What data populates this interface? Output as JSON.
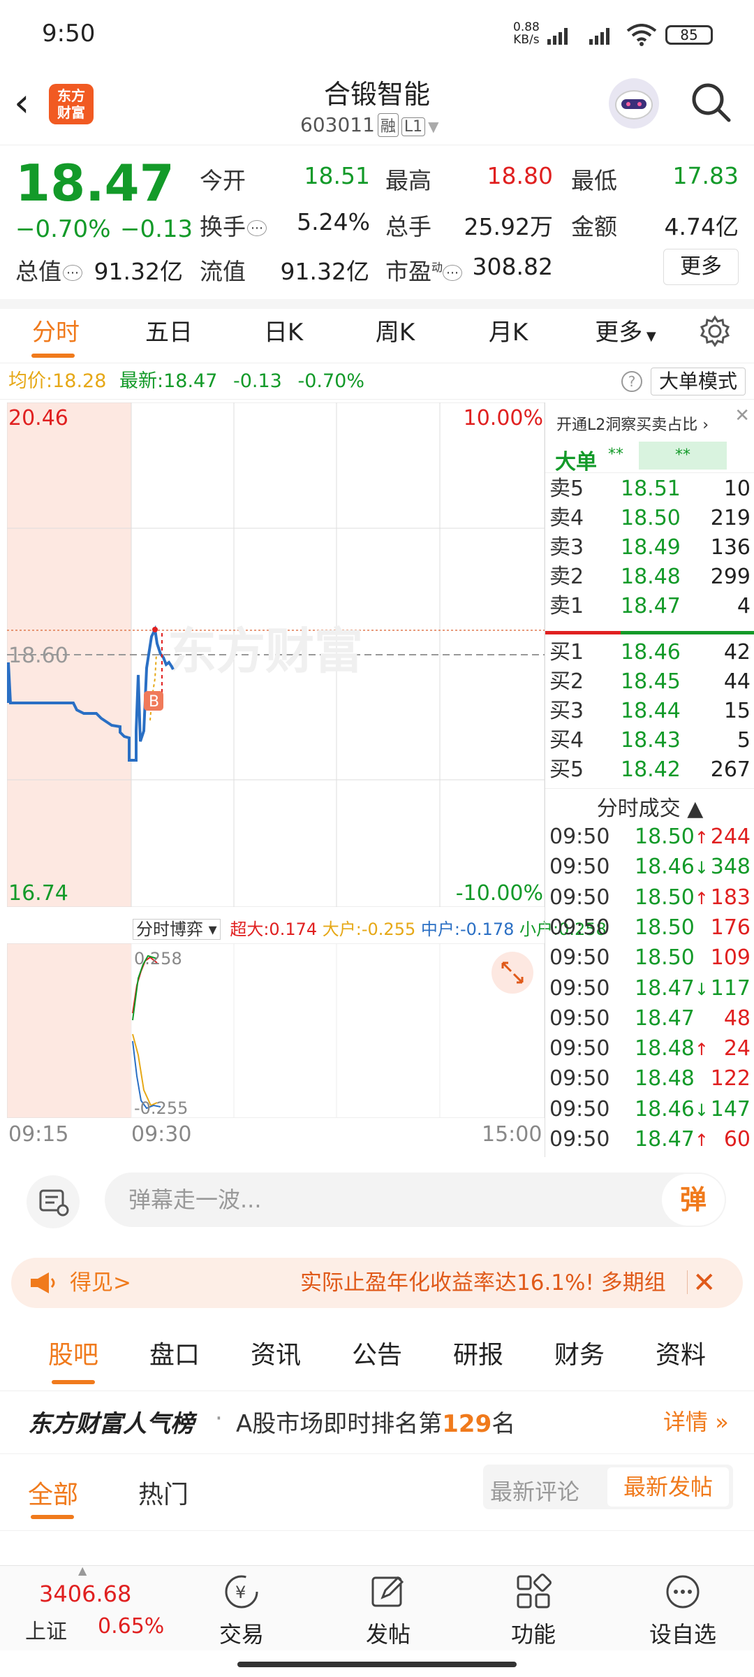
{
  "status": {
    "time": "9:50",
    "net_speed_value": "0.88",
    "net_speed_unit": "KB/s",
    "battery": "85"
  },
  "header": {
    "title": "合锻智能",
    "code": "603011",
    "tag_rong": "融",
    "tag_level": "L1",
    "logo_line1": "东方",
    "logo_line2": "财富"
  },
  "quote": {
    "price": "18.47",
    "change_pct": "−0.70%",
    "change_abs": "−0.13",
    "open_label": "今开",
    "open": "18.51",
    "high_label": "最高",
    "high": "18.80",
    "low_label": "最低",
    "low": "17.83",
    "turnover_label": "换手",
    "turnover": "5.24%",
    "volume_label": "总手",
    "volume": "25.92万",
    "amount_label": "金额",
    "amount": "4.74亿",
    "mktcap_label": "总值",
    "mktcap": "91.32亿",
    "float_label": "流值",
    "float": "91.32亿",
    "pe_label": "市盈",
    "pe_sup": "动",
    "pe": "308.82",
    "more": "更多"
  },
  "tabs": [
    "分时",
    "五日",
    "日K",
    "周K",
    "月K",
    "更多"
  ],
  "infobar": {
    "avg_label": "均价:",
    "avg": "18.28",
    "latest_label": "最新:",
    "latest": "18.47",
    "chg": "-0.13",
    "pct": "-0.70%",
    "mode": "大单模式"
  },
  "chart_data": {
    "type": "line",
    "y_top": "20.46",
    "y_mid": "18.60",
    "y_bottom": "16.74",
    "pct_top": "10.00%",
    "pct_bottom": "-10.00%",
    "watermark": "东方财富",
    "marker": "B",
    "x_labels": [
      "09:15",
      "09:30",
      "15:00"
    ],
    "sub_selector": "分时博弈",
    "flows": {
      "super_label": "超大",
      "super": "0.174",
      "large_label": "大户",
      "large": "-0.255",
      "mid_label": "中户",
      "mid": "-0.178",
      "small_label": "小户",
      "small": "0.258"
    },
    "sub_top": "0.258",
    "sub_bottom": "-0.255"
  },
  "orderbook": {
    "l2_promo": "开通L2洞察买卖占比",
    "big_order_label": "大单",
    "asks": [
      [
        "卖5",
        "18.51",
        "10"
      ],
      [
        "卖4",
        "18.50",
        "219"
      ],
      [
        "卖3",
        "18.49",
        "136"
      ],
      [
        "卖2",
        "18.48",
        "299"
      ],
      [
        "卖1",
        "18.47",
        "4"
      ]
    ],
    "bids": [
      [
        "买1",
        "18.46",
        "42"
      ],
      [
        "买2",
        "18.45",
        "44"
      ],
      [
        "买3",
        "18.44",
        "15"
      ],
      [
        "买4",
        "18.43",
        "5"
      ],
      [
        "买5",
        "18.42",
        "267"
      ]
    ],
    "trades_title": "分时成交",
    "trades": [
      [
        "09:50",
        "18.50",
        "↑",
        "244"
      ],
      [
        "09:50",
        "18.46",
        "↓",
        "348"
      ],
      [
        "09:50",
        "18.50",
        "↑",
        "183"
      ],
      [
        "09:50",
        "18.50",
        "",
        "176"
      ],
      [
        "09:50",
        "18.50",
        "",
        "109"
      ],
      [
        "09:50",
        "18.47",
        "↓",
        "117"
      ],
      [
        "09:50",
        "18.47",
        "",
        "48"
      ],
      [
        "09:50",
        "18.48",
        "↑",
        "24"
      ],
      [
        "09:50",
        "18.48",
        "",
        "122"
      ],
      [
        "09:50",
        "18.46",
        "↓",
        "147"
      ],
      [
        "09:50",
        "18.47",
        "↑",
        "60"
      ]
    ]
  },
  "danmu": {
    "placeholder": "弹幕走一波...",
    "button": "弹"
  },
  "banner": {
    "left": "得见>",
    "text": "实际止盈年化收益率达16.1%! 多期组"
  },
  "section_tabs": [
    "股吧",
    "盘口",
    "资讯",
    "公告",
    "研报",
    "财务",
    "资料"
  ],
  "popular": {
    "brand": "东方财富人气榜",
    "text_prefix": "A股市场即时排名第",
    "rank": "129",
    "text_suffix": "名",
    "detail": "详情"
  },
  "filter": {
    "tab_all": "全部",
    "tab_hot": "热门",
    "sort_comment": "最新评论",
    "sort_post": "最新发帖"
  },
  "bottom": {
    "index_value": "3406.68",
    "index_name": "上证",
    "index_pct": "0.65%",
    "nav": [
      "交易",
      "发帖",
      "功能",
      "设自选"
    ]
  }
}
